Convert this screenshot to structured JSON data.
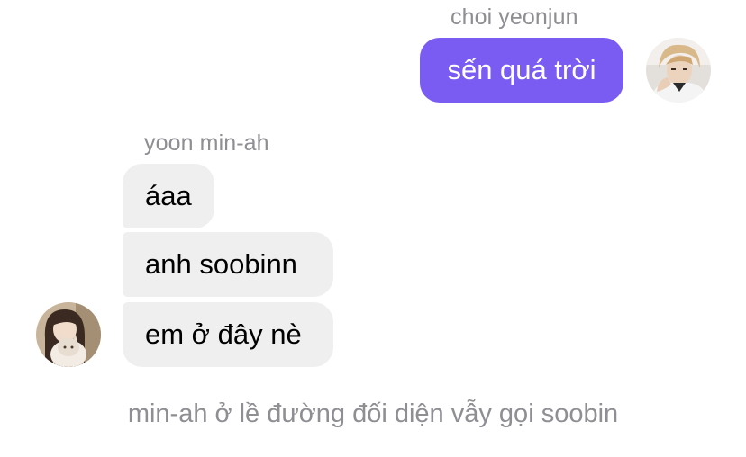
{
  "chat": {
    "outgoing": {
      "sender": "choi yeonjun",
      "avatar_icon": "user-avatar-yeonjun-icon",
      "messages": [
        "sến quá trời"
      ]
    },
    "incoming": {
      "sender": "yoon min-ah",
      "avatar_icon": "user-avatar-minah-icon",
      "messages": [
        "áaa",
        "anh soobinn",
        "em ở đây nè"
      ]
    },
    "narration": "min-ah ở lề đường đối diện vẫy gọi soobin"
  },
  "colors": {
    "outgoing_bubble": "#7b5cf2",
    "incoming_bubble": "#efeff0",
    "meta_text": "#8e8e93"
  }
}
